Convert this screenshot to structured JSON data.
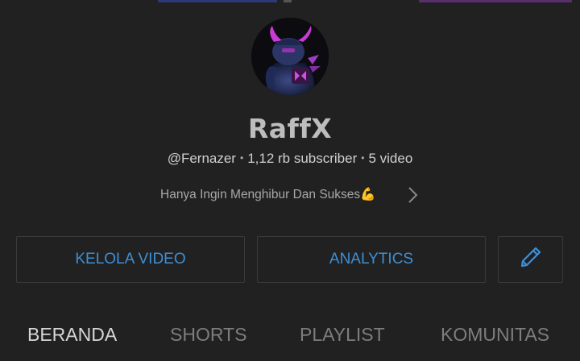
{
  "channel": {
    "name": "RaffX",
    "handle": "@Fernazer",
    "subscribers": "1,12 rb subscriber",
    "videos": "5 video",
    "separator": "•",
    "description": "Hanya Ingin Menghibur Dan Sukses💪",
    "avatar_icon": "pekka-avatar-icon"
  },
  "actions": {
    "manage_videos_label": "KELOLA VIDEO",
    "analytics_label": "ANALYTICS",
    "edit_icon": "pencil-icon"
  },
  "tabs": [
    {
      "label": "BERANDA",
      "active": true
    },
    {
      "label": "SHORTS",
      "active": false
    },
    {
      "label": "PLAYLIST",
      "active": false
    },
    {
      "label": "KOMUNITAS",
      "active": false
    }
  ],
  "colors": {
    "background": "#212121",
    "accent_blue": "#3e8fd6",
    "tab_active": "#d6d6d6",
    "tab_inactive": "#7d7d7d"
  }
}
